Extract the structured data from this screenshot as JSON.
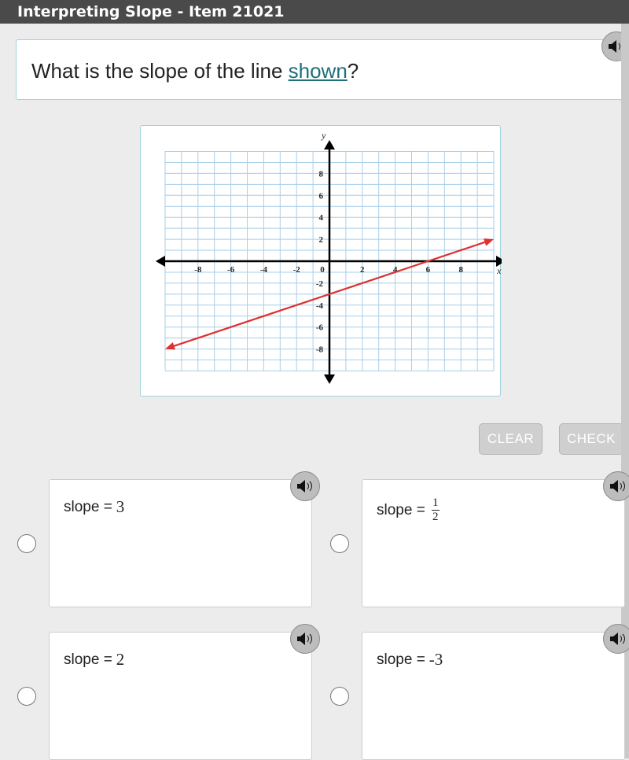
{
  "window": {
    "title": "Interpreting Slope - Item 21021"
  },
  "question": {
    "prefix": "What is the slope of the line ",
    "link": "shown",
    "suffix": "?"
  },
  "buttons": {
    "clear": "CLEAR",
    "check": "CHECK"
  },
  "choices": [
    {
      "label": "slope = ",
      "value": "3"
    },
    {
      "label": "slope = ",
      "numerator": "1",
      "denominator": "2"
    },
    {
      "label": "slope = ",
      "value": "2"
    },
    {
      "label": "slope = ",
      "value": "-3"
    }
  ],
  "chart_data": {
    "type": "line",
    "title": "",
    "xlabel": "x",
    "ylabel": "y",
    "xlim": [
      -10,
      10
    ],
    "ylim": [
      -10,
      10
    ],
    "grid": true,
    "x_ticks": [
      "-8",
      "-6",
      "-4",
      "-2",
      "0",
      "2",
      "4",
      "6",
      "8"
    ],
    "y_ticks": [
      "8",
      "6",
      "4",
      "2",
      "-2",
      "-4",
      "-6",
      "-8"
    ],
    "series": [
      {
        "name": "line",
        "color": "#e03030",
        "points": [
          [
            -10,
            -8.333
          ],
          [
            10,
            0
          ]
        ],
        "slope": 0.5,
        "intercept": -3
      }
    ],
    "line_points": [
      [
        -10,
        -8
      ],
      [
        0,
        -3
      ],
      [
        6,
        0
      ],
      [
        10,
        2
      ]
    ]
  }
}
